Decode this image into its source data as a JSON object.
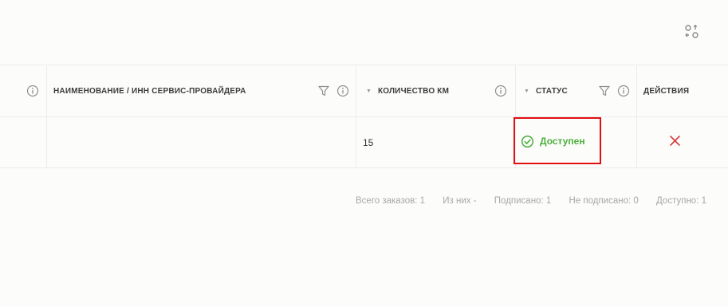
{
  "toolbar": {
    "settings_icon": "column-settings-icon"
  },
  "table": {
    "columns": [
      {
        "key": "info",
        "label": "",
        "icons": [
          "info-icon"
        ]
      },
      {
        "key": "name",
        "label": "НАИМЕНОВАНИЕ / ИНН СЕРВИС-ПРОВАЙДЕРА",
        "icons": [
          "filter-icon",
          "info-icon"
        ]
      },
      {
        "key": "km",
        "label": "КОЛИЧЕСТВО КМ",
        "icons": [
          "sort-caret-icon",
          "info-icon"
        ]
      },
      {
        "key": "status",
        "label": "СТАТУС",
        "icons": [
          "sort-caret-icon",
          "filter-icon",
          "info-icon"
        ]
      },
      {
        "key": "actions",
        "label": "ДЕЙСТВИЯ",
        "icons": []
      }
    ],
    "rows": [
      {
        "info": "",
        "name": "",
        "km": "15",
        "status": "Доступен",
        "status_icon": "check-circle-icon",
        "action_icon": "close-icon"
      }
    ]
  },
  "colors": {
    "status_ok": "#4caf3c",
    "delete": "#d63a3a",
    "highlight_border": "#e01010",
    "muted_text": "#a7a7a7"
  },
  "footer": {
    "total": "Всего заказов: 1",
    "of_them": "Из них -",
    "signed": "Подписано: 1",
    "unsigned": "Не подписано: 0",
    "available": "Доступно: 1"
  }
}
